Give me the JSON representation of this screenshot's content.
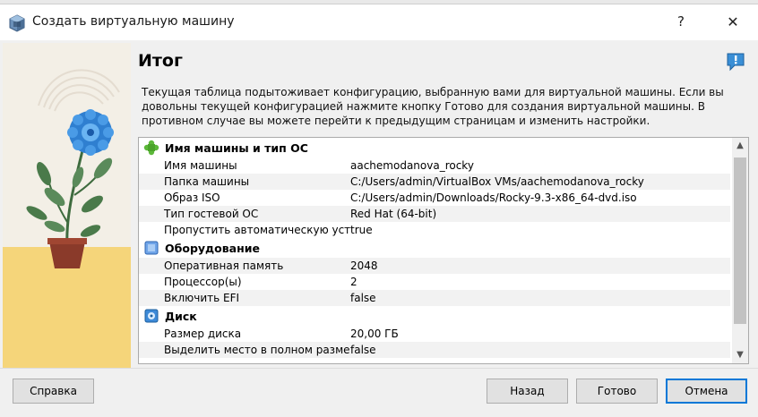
{
  "window": {
    "title": "Создать виртуальную машину",
    "help_symbol": "?",
    "close_symbol": "✕"
  },
  "page": {
    "heading": "Итог",
    "description": "Текущая таблица подытоживает конфигурацию, выбранную вами для виртуальной машины. Если вы довольны текущей конфигурацией нажмите кнопку Готово для создания виртуальной машины. В противном случае вы можете перейти к предыдущим страницам и изменить настройки."
  },
  "summary": {
    "section_name_os": "Имя машины и тип ОС",
    "name_os_rows": [
      {
        "key": "Имя машины",
        "value": "aachemodanova_rocky"
      },
      {
        "key": "Папка машины",
        "value": "C:/Users/admin/VirtualBox VMs/aachemodanova_rocky"
      },
      {
        "key": "Образ ISO",
        "value": "C:/Users/admin/Downloads/Rocky-9.3-x86_64-dvd.iso"
      },
      {
        "key": "Тип гостевой ОС",
        "value": "Red Hat (64-bit)"
      },
      {
        "key": "Пропустить автоматическую установку",
        "value": "true"
      }
    ],
    "section_hardware": "Оборудование",
    "hardware_rows": [
      {
        "key": "Оперативная память",
        "value": "2048"
      },
      {
        "key": "Процессор(ы)",
        "value": "2"
      },
      {
        "key": "Включить EFI",
        "value": "false"
      }
    ],
    "section_disk": "Диск",
    "disk_rows": [
      {
        "key": "Размер диска",
        "value": "20,00 ГБ"
      },
      {
        "key": "Выделить место в полном размере",
        "value": "false"
      }
    ]
  },
  "buttons": {
    "help": "Справка",
    "back": "Назад",
    "done": "Готово",
    "cancel": "Отмена"
  },
  "colors": {
    "accent": "#0078d7",
    "panel_sun": "#f5d57a",
    "panel_bg": "#f3efe6"
  }
}
